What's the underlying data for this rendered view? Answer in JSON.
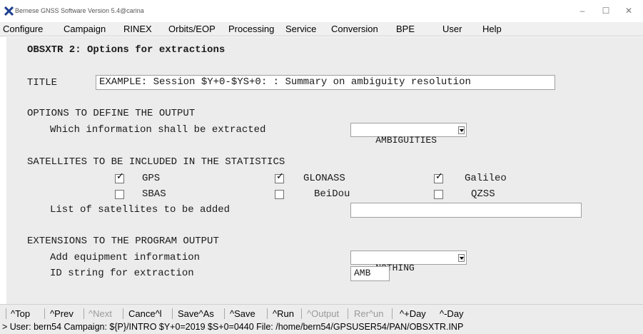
{
  "window": {
    "title": "Bernese GNSS Software Version 5.4@carina",
    "icon": "x-logo-icon",
    "controls": {
      "minimize": "–",
      "maximize": "☐",
      "close": "✕"
    }
  },
  "menu": {
    "items": [
      "Configure",
      "Campaign",
      "RINEX",
      "Orbits/EOP",
      "Processing",
      "Service",
      "Conversion",
      "BPE",
      "User",
      "Help"
    ]
  },
  "panel": {
    "heading": "OBSXTR 2: Options for extractions",
    "title_label": "TITLE",
    "title_value": "EXAMPLE: Session $Y+0-$YS+0: : Summary on ambiguity resolution",
    "output": {
      "section": "OPTIONS TO DEFINE THE OUTPUT",
      "extract_label": "Which information shall be extracted",
      "extract_value": "AMBIGUITIES"
    },
    "satellites": {
      "section": "SATELLITES TO BE INCLUDED IN THE STATISTICS",
      "systems": [
        {
          "label": "GPS",
          "checked": true
        },
        {
          "label": "GLONASS",
          "checked": true
        },
        {
          "label": "Galileo",
          "checked": true
        },
        {
          "label": "SBAS",
          "checked": false
        },
        {
          "label": "BeiDou",
          "checked": false
        },
        {
          "label": "QZSS",
          "checked": false
        }
      ],
      "add_label": "List of satellites to be added",
      "add_value": ""
    },
    "extensions": {
      "section": "EXTENSIONS TO THE PROGRAM OUTPUT",
      "equipment_label": "Add equipment information",
      "equipment_value": "NOTHING",
      "id_label": "ID string for extraction",
      "id_value": "AMB"
    }
  },
  "buttons": [
    {
      "label": "^Top",
      "enabled": true
    },
    {
      "label": "^Prev",
      "enabled": true
    },
    {
      "label": "^Next",
      "enabled": false
    },
    {
      "label": "Cance^l",
      "enabled": true
    },
    {
      "label": "Save^As",
      "enabled": true
    },
    {
      "label": "^Save",
      "enabled": true
    },
    {
      "label": "^Run",
      "enabled": true
    },
    {
      "label": "^Output",
      "enabled": false
    },
    {
      "label": "Rer^un",
      "enabled": false
    },
    {
      "label": "^+Day",
      "enabled": true
    },
    {
      "label": "^-Day",
      "enabled": true
    }
  ],
  "status": "> User: bern54  Campaign: ${P}/INTRO  $Y+0=2019  $S+0=0440   File: /home/bern54/GPSUSER54/PAN/OBSXTR.INP",
  "colors": {
    "panel_bg": "#ececec",
    "field_bg": "#ffffff",
    "disabled_text": "#9a9a9a",
    "logo_blue": "#1f3f8f"
  }
}
